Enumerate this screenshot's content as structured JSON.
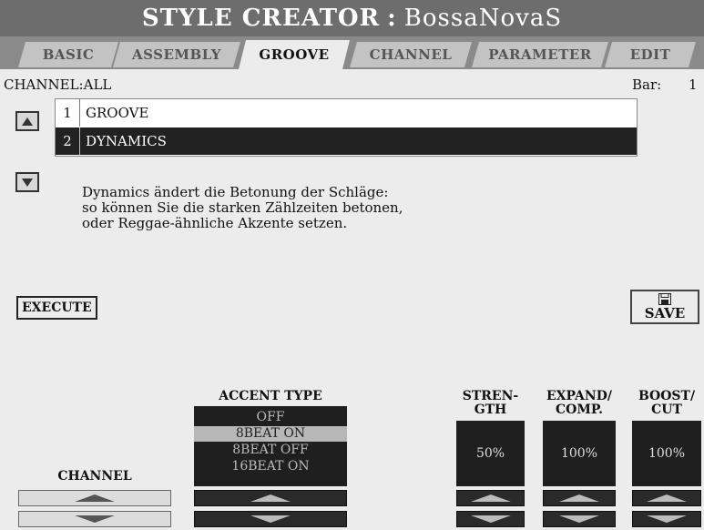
{
  "title": {
    "prefix": "STYLE CREATOR",
    "separator": ":",
    "style_name": "BossaNovaS"
  },
  "tabs": [
    {
      "label": "BASIC"
    },
    {
      "label": "ASSEMBLY"
    },
    {
      "label": "GROOVE"
    },
    {
      "label": "CHANNEL"
    },
    {
      "label": "PARAMETER"
    },
    {
      "label": "EDIT"
    }
  ],
  "active_tab": "GROOVE",
  "info": {
    "channel": "CHANNEL:ALL",
    "bar_label": "Bar:",
    "bar_value": "1"
  },
  "list": {
    "items": [
      {
        "num": "1",
        "label": "GROOVE"
      },
      {
        "num": "2",
        "label": "DYNAMICS"
      }
    ],
    "selected": "DYNAMICS"
  },
  "description": {
    "line1": "Dynamics ändert die Betonung der Schläge:",
    "line2": "so können Sie die starken Zählzeiten betonen,",
    "line3": "oder Reggae-ähnliche Akzente setzen."
  },
  "buttons": {
    "execute": "EXECUTE",
    "save": "SAVE"
  },
  "controls": {
    "channel": {
      "label": "CHANNEL"
    },
    "accent_type": {
      "label": "ACCENT TYPE",
      "options": [
        "OFF",
        "8BEAT ON",
        "8BEAT OFF",
        "16BEAT ON"
      ],
      "selected": "8BEAT ON"
    },
    "strength": {
      "label_line1": "STREN-",
      "label_line2": "GTH",
      "value": "50%"
    },
    "expand_comp": {
      "label_line1": "EXPAND/",
      "label_line2": "COMP.",
      "value": "100%"
    },
    "boost_cut": {
      "label_line1": "BOOST/",
      "label_line2": "CUT",
      "value": "100%"
    }
  },
  "icons": {
    "scroll_up": "triangle-up-icon",
    "scroll_down": "triangle-down-icon",
    "save": "floppy-disk-icon"
  },
  "colors": {
    "title_bg": "#6d6d6d",
    "tab_bar_bg": "#8a8a8a",
    "selected_row_bg": "#222222",
    "value_box_bg": "#1f1f1f"
  }
}
